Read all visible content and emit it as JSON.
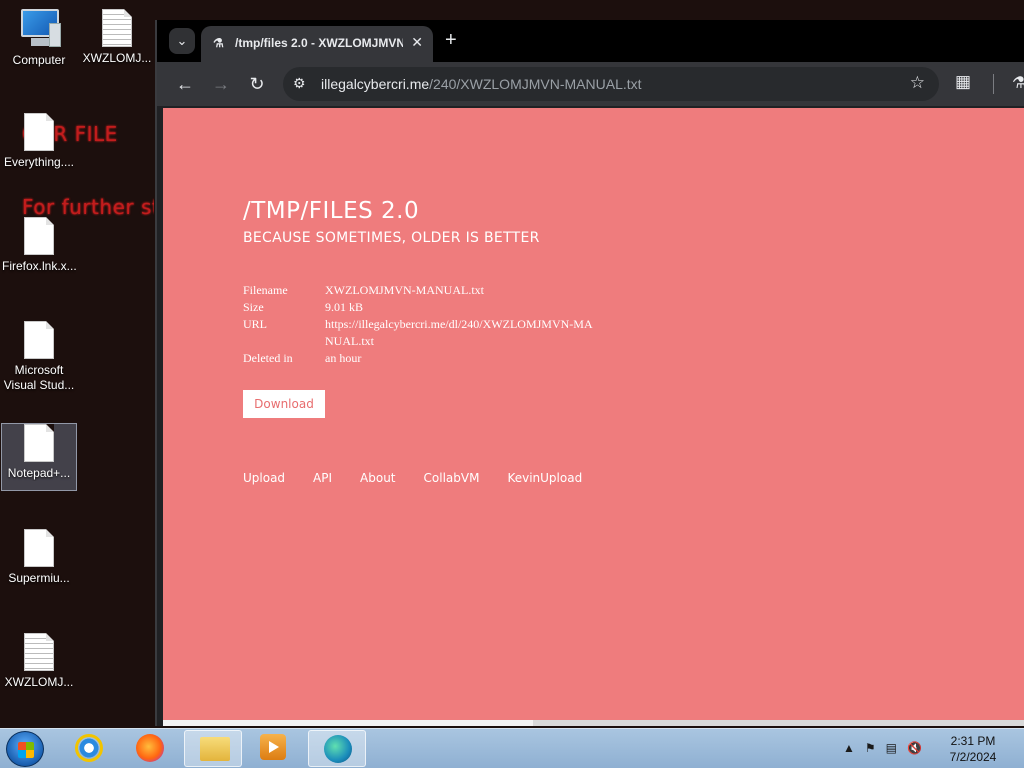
{
  "desktop": {
    "wallpaper_lines": [
      "OUR FILE",
      "For further st"
    ],
    "icons": [
      {
        "label": "Computer",
        "icon": "computer-icon"
      },
      {
        "label": "XWZLOMJ...",
        "icon": "text-file-icon"
      },
      {
        "label": "Everything....",
        "icon": "file-icon"
      },
      {
        "label": "Firefox.lnk.x...",
        "icon": "file-icon"
      },
      {
        "label": "Microsoft Visual Stud...",
        "icon": "file-icon"
      },
      {
        "label": "Notepad+...",
        "icon": "file-icon"
      },
      {
        "label": "Supermiu...",
        "icon": "file-icon"
      },
      {
        "label": "XWZLOMJ...",
        "icon": "text-file-icon"
      }
    ]
  },
  "browser": {
    "tab_title": "/tmp/files 2.0 - XWZLOMJMVN",
    "url_host": "illegalcybercri.me",
    "url_path": "/240/XWZLOMJMVN-MANUAL.txt"
  },
  "page": {
    "title": "/TMP/FILES 2.0",
    "subtitle": "BECAUSE SOMETIMES, OLDER IS BETTER",
    "file_info": [
      {
        "key": "Filename",
        "value": "XWZLOMJMVN-MANUAL.txt"
      },
      {
        "key": "Size",
        "value": "9.01 kB"
      },
      {
        "key": "URL",
        "value": "https://illegalcybercri.me/dl/240/XWZLOMJMVN-MANUAL.txt"
      },
      {
        "key": "Deleted in",
        "value": "an hour"
      }
    ],
    "download_label": "Download",
    "footer_links": [
      "Upload",
      "API",
      "About",
      "CollabVM",
      "KevinUpload"
    ]
  },
  "taskbar": {
    "time": "2:31 PM",
    "date": "7/2/2024"
  },
  "colors": {
    "page_background": "#ef7c7d",
    "wallpaper_text": "#c21d1d"
  }
}
